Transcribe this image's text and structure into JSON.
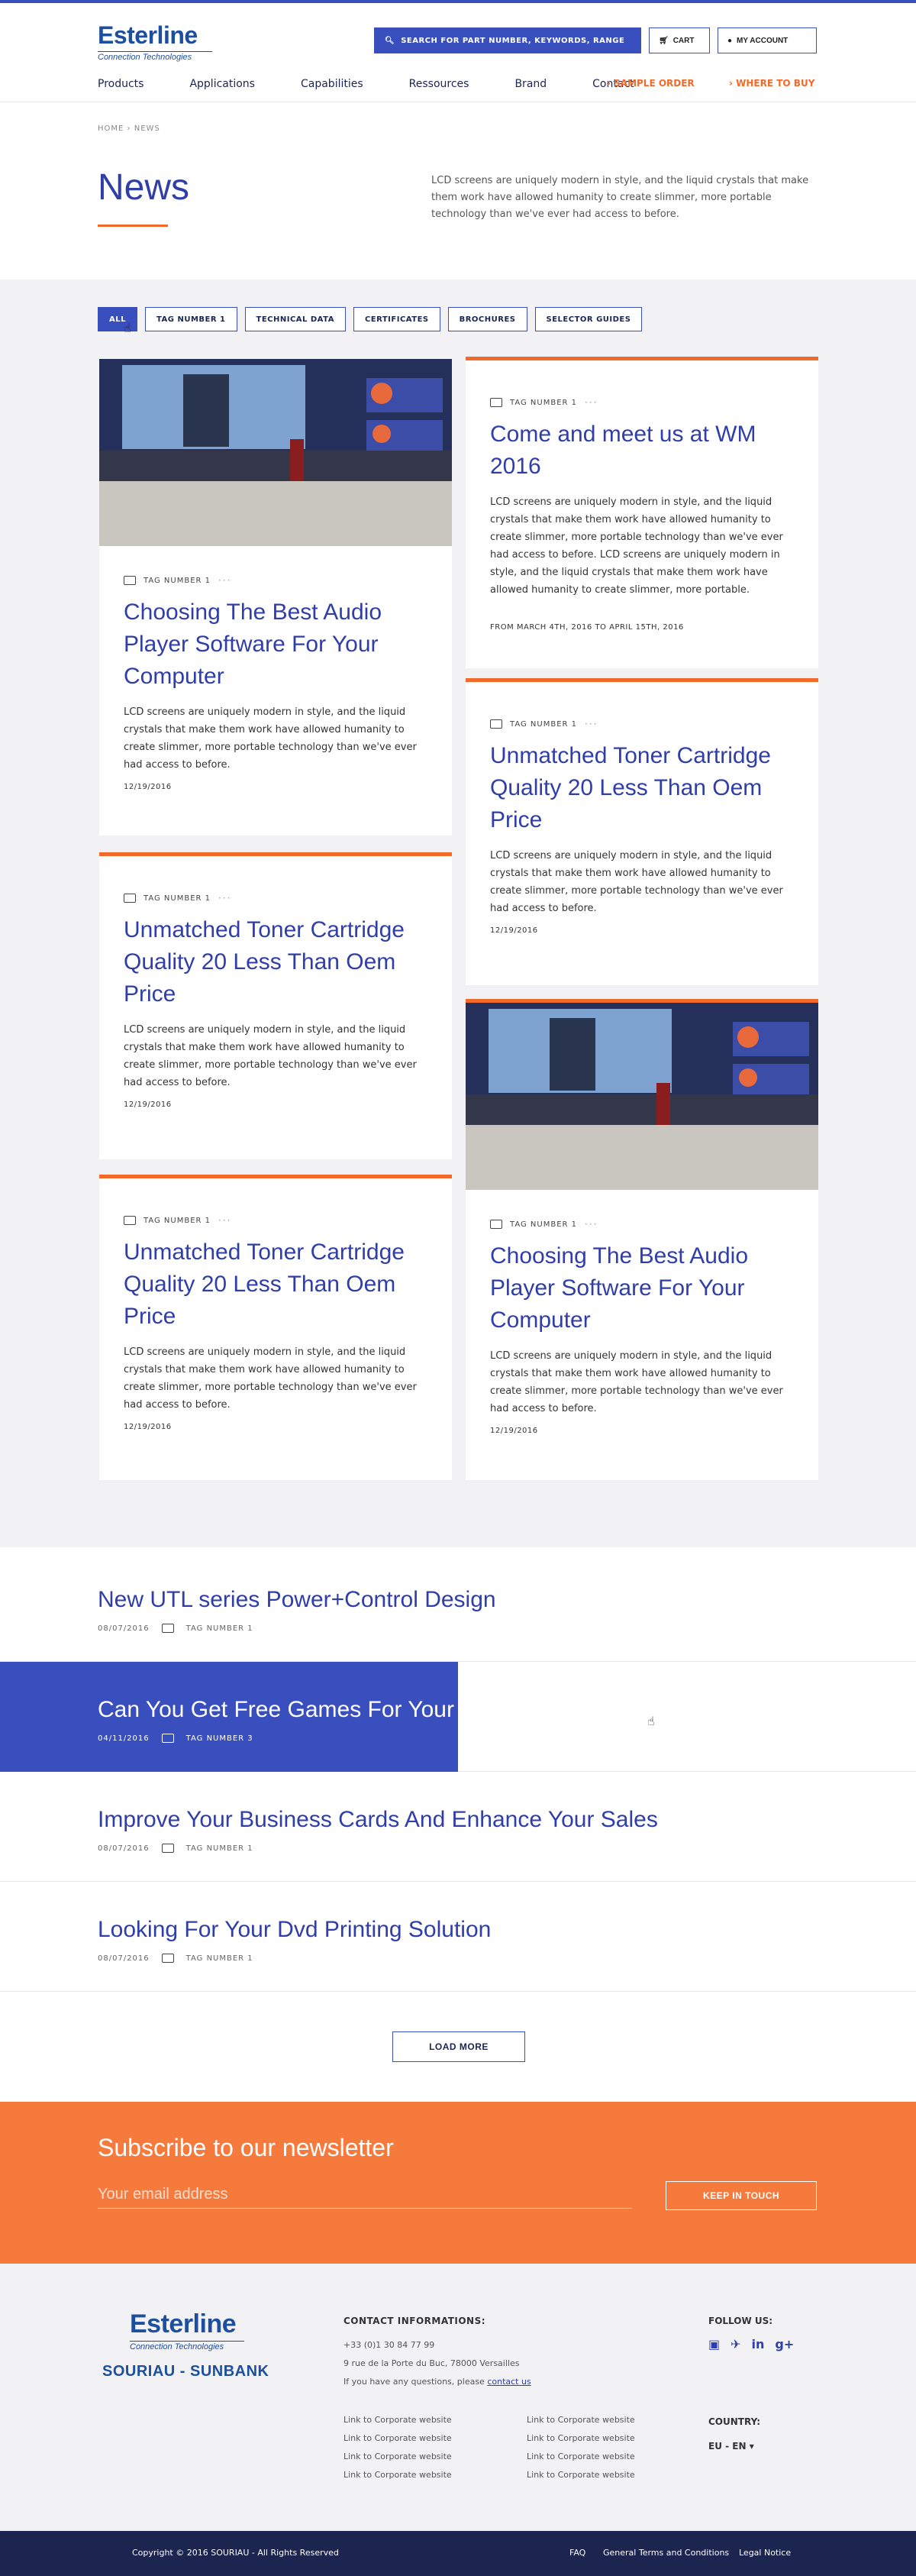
{
  "header": {
    "logo": {
      "main": "Esterline",
      "sub": "Connection Technologies"
    },
    "search_label": "SEARCH FOR PART NUMBER, KEYWORDS, RANGE",
    "cart_label": "CART",
    "account_label": "MY ACCOUNT",
    "nav": [
      "Products",
      "Applications",
      "Capabilities",
      "Ressources",
      "Brand",
      "Contact"
    ],
    "sample_order": "SAMPLE ORDER",
    "where_to_buy": "WHERE TO BUY",
    "accent": "#f26a2a",
    "primary": "#3a4fbe"
  },
  "breadcrumb": {
    "home": "HOME",
    "current": "NEWS"
  },
  "hero": {
    "title": "News",
    "text": "LCD screens are uniquely modern in style, and the liquid crystals that make them work have allowed humanity to create slimmer, more portable technology than we've ever had access to before."
  },
  "filters": [
    "ALL",
    "TAG NUMBER 1",
    "TECHNICAL DATA",
    "CERTIFICATES",
    "BROCHURES",
    "SELECTOR GUIDES"
  ],
  "cards": [
    {
      "tag": "TAG NUMBER 1",
      "title": "Choosing The Best Audio Player Software For Your Computer",
      "text": "LCD screens are uniquely modern in style, and the liquid crystals that make them work have allowed humanity to create slimmer, more portable technology than we've ever had access to before.",
      "date": "12/19/2016"
    },
    {
      "tag": "TAG NUMBER 1",
      "title": "Come and meet us at WM 2016",
      "text": "LCD screens are uniquely modern in style, and the liquid crystals that make them work have allowed humanity to create slimmer, more portable technology than we've ever had access to before. LCD screens are uniquely modern in style, and the liquid crystals that make them work have allowed humanity to create slimmer, more portable.",
      "date": "FROM MARCH 4TH, 2016 TO APRIL 15TH, 2016"
    },
    {
      "tag": "TAG NUMBER 1",
      "title": "Unmatched Toner Cartridge Quality 20 Less Than Oem Price",
      "text": "LCD screens are uniquely modern in style, and the liquid crystals that make them work have allowed humanity to create slimmer, more portable technology than we've ever had access to before.",
      "date": "12/19/2016"
    },
    {
      "tag": "TAG NUMBER 1",
      "title": "Unmatched Toner Cartridge Quality 20 Less Than Oem Price",
      "text": "LCD screens are uniquely modern in style, and the liquid crystals that make them work have allowed humanity to create slimmer, more portable technology than we've ever had access to before.",
      "date": "12/19/2016"
    },
    {
      "tag": "TAG NUMBER 1",
      "title": "Choosing The Best Audio Player Software For Your Computer",
      "text": "LCD screens are uniquely modern in style, and the liquid crystals that make them work have allowed humanity to create slimmer, more portable technology than we've ever had access to before.",
      "date": "12/19/2016"
    },
    {
      "tag": "TAG NUMBER 1",
      "title": "Unmatched Toner Cartridge Quality 20 Less Than Oem Price",
      "text": "LCD screens are uniquely modern in style, and the liquid crystals that make them work have allowed humanity to create slimmer, more portable technology than we've ever had access to before.",
      "date": "12/19/2016"
    }
  ],
  "list": [
    {
      "title": "New UTL series Power+Control Design",
      "date": "08/07/2016",
      "tag": "TAG NUMBER 1"
    },
    {
      "title": "Can You Get Free Games For Your Iphone",
      "date": "04/11/2016",
      "tag": "TAG NUMBER 3"
    },
    {
      "title": "Improve Your Business Cards And Enhance Your Sales",
      "date": "08/07/2016",
      "tag": "TAG NUMBER 1"
    },
    {
      "title": "Looking For Your Dvd Printing Solution",
      "date": "08/07/2016",
      "tag": "TAG NUMBER 1"
    }
  ],
  "load_more": "LOAD MORE",
  "newsletter": {
    "title": "Subscribe to our newsletter",
    "placeholder": "Your email address",
    "button": "KEEP IN TOUCH"
  },
  "footer": {
    "brand2": "SOURIAU - SUNBANK",
    "contact_heading": "CONTACT INFORMATIONS:",
    "phone": "+33 (0)1 30 84 77 99",
    "address": "9 rue de la Porte du Buc, 78000 Versailles",
    "question_text": "If you have any questions, please",
    "contact_link": "contact us",
    "links_col1": [
      "Link to Corporate website",
      "Link to Corporate website",
      "Link to Corporate website",
      "Link to Corporate website"
    ],
    "links_col2": [
      "Link to Corporate website",
      "Link to Corporate website",
      "Link to Corporate website",
      "Link to Corporate website"
    ],
    "follow_heading": "FOLLOW US:",
    "socials": [
      "youtube-icon",
      "twitter-icon",
      "linkedin-icon",
      "google-plus-icon"
    ],
    "country_heading": "COUNTRY:",
    "country_value": "EU - EN"
  },
  "bottom": {
    "copyright": "Copyright © 2016 SOURIAU - All Rights Reserved",
    "faq": "FAQ",
    "terms": "General Terms and Conditions",
    "legal": "Legal Notice"
  }
}
